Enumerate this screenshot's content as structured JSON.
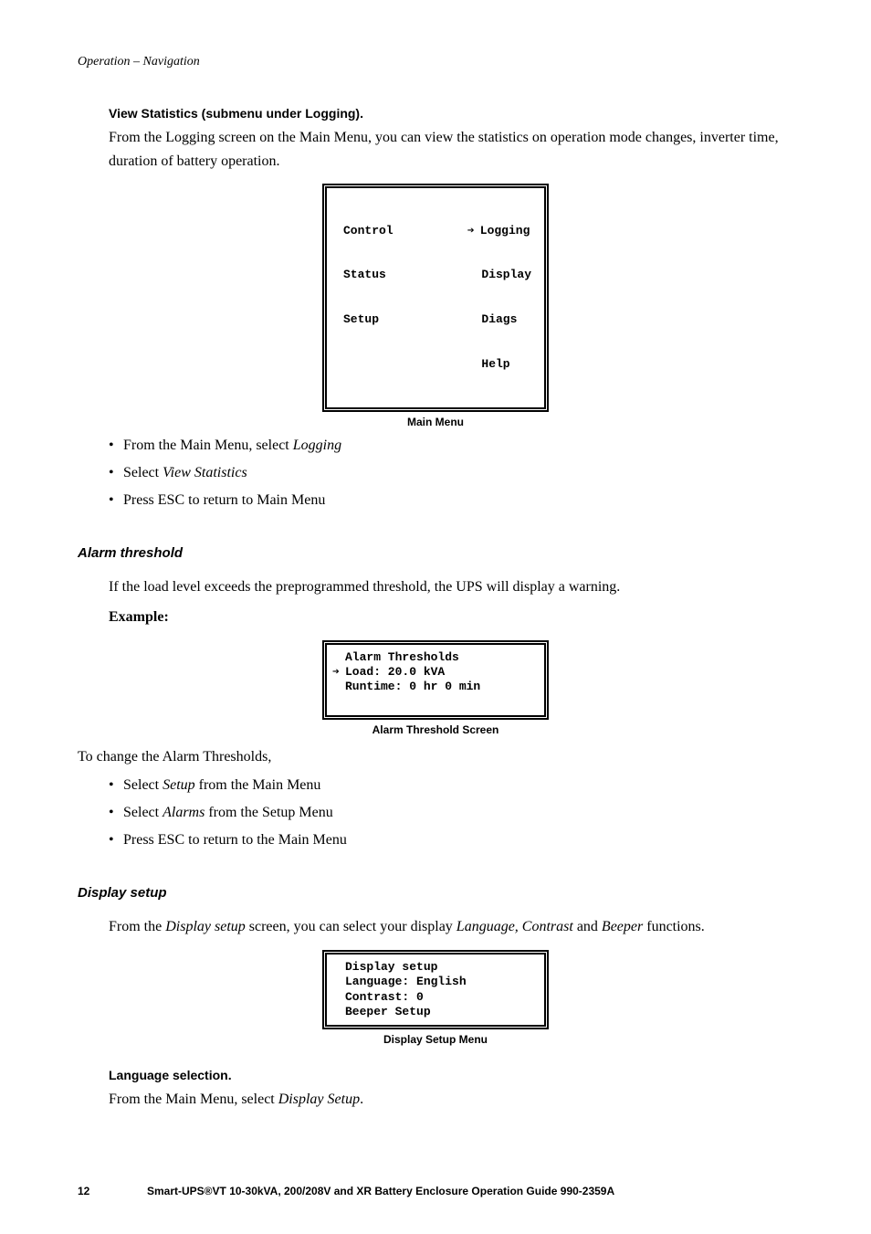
{
  "header": {
    "breadcrumb": "Operation – Navigation"
  },
  "section_view_stats": {
    "heading": "View Statistics (submenu under Logging).",
    "intro": "From the Logging screen on the Main Menu, you can view the statistics on operation mode changes, inverter time, duration of battery operation.",
    "menu_screen": {
      "left": [
        "Control",
        "Status",
        "Setup"
      ],
      "right_selected": "Logging",
      "right": [
        "Display",
        "Diags",
        "Help"
      ],
      "caption": "Main Menu"
    },
    "steps": {
      "s1_pre": "From the Main Menu, select ",
      "s1_ital": "Logging",
      "s2_pre": "Select ",
      "s2_ital": "View Statistics",
      "s3": "Press ESC to return to Main Menu"
    }
  },
  "section_alarm": {
    "heading": "Alarm threshold",
    "intro": "If the load level exceeds the preprogrammed threshold, the UPS will display a warning.",
    "example_label": "Example:",
    "screen": {
      "l1": "Alarm Thresholds",
      "l2": "Load: 20.0 kVA",
      "l3": "Runtime: 0 hr 0 min",
      "caption": "Alarm Threshold Screen"
    },
    "after": "To change the Alarm Thresholds,",
    "steps": {
      "s1_pre": "Select ",
      "s1_ital": "Setup",
      "s1_post": " from the Main Menu",
      "s2_pre": "Select ",
      "s2_ital": "Alarms",
      "s2_post": " from the Setup Menu",
      "s3": "Press ESC to return to the Main Menu"
    }
  },
  "section_display": {
    "heading": "Display setup",
    "intro_pre": "From the ",
    "intro_ital1": "Display setup",
    "intro_mid": " screen, you can select your display ",
    "intro_ital2": "Language, Contrast",
    "intro_and": " and ",
    "intro_ital3": "Beeper",
    "intro_post": " functions.",
    "screen": {
      "l1": "Display setup",
      "l2": "Language: English",
      "l3": "Contrast: 0",
      "l4": "Beeper Setup",
      "caption": "Display Setup Menu"
    },
    "lang_heading": "Language selection.",
    "lang_text_pre": "From the Main Menu, select ",
    "lang_text_ital": "Display Setup",
    "lang_text_post": "."
  },
  "footer": {
    "page": "12",
    "text": "Smart-UPS®VT 10-30kVA, 200/208V and XR Battery Enclosure Operation Guide    990-2359A"
  },
  "glyphs": {
    "arrow": "➔"
  }
}
